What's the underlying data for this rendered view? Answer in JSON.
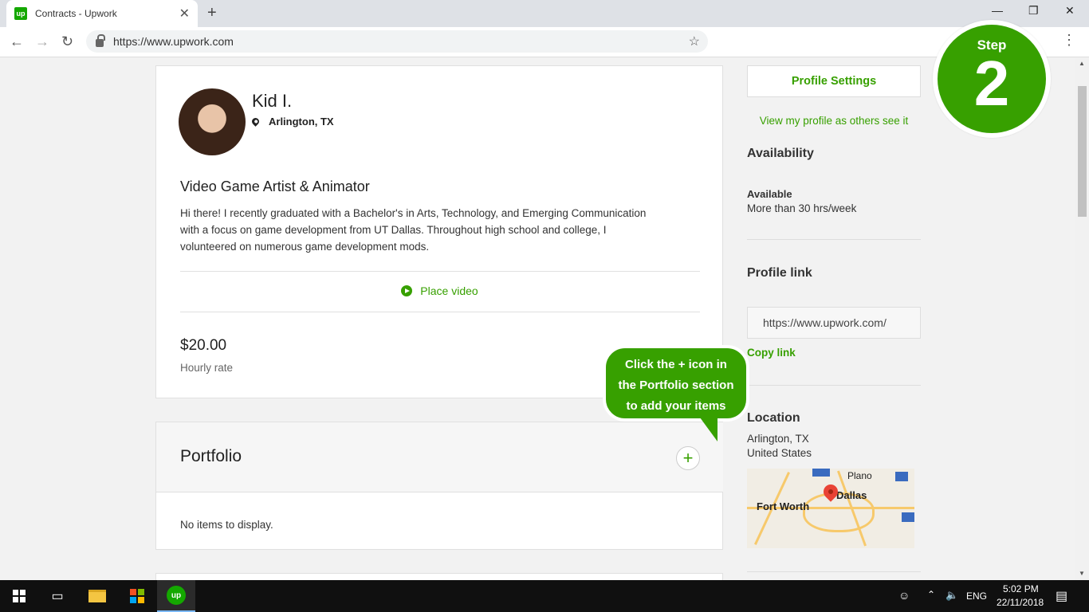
{
  "browser": {
    "tab_title": "Contracts - Upwork",
    "tab_favicon": "up",
    "url": "https://www.upwork.com"
  },
  "profile": {
    "name": "Kid I.",
    "location": "Arlington, TX",
    "headline": "Video Game Artist & Animator",
    "bio": "Hi there! I recently graduated with a Bachelor's in Arts, Technology, and Emerging Communication with a focus on game development from UT Dallas. Throughout high school and college, I volunteered on numerous game development mods.",
    "place_video_label": "Place video",
    "rate": "$20.00",
    "rate_label": "Hourly rate"
  },
  "portfolio": {
    "title": "Portfolio",
    "add_icon": "+",
    "empty_text": "No items to display."
  },
  "sidebar": {
    "settings_label": "Profile Settings",
    "view_profile_label": "View my profile as others see it",
    "availability_heading": "Availability",
    "availability_status": "Available",
    "availability_hours": "More than 30 hrs/week",
    "profile_link_heading": "Profile link",
    "profile_link_value": "https://www.upwork.com/",
    "copy_link_label": "Copy link",
    "location_heading": "Location",
    "location_city": "Arlington, TX",
    "location_country": "United States",
    "map_labels": {
      "plano": "Plano",
      "dallas": "Dallas",
      "fort_worth": "Fort Worth"
    }
  },
  "overlay": {
    "step_label": "Step",
    "step_number": "2",
    "callout_line1": "Click the + icon in",
    "callout_line2": "the Portfolio section",
    "callout_line3": "to add your items"
  },
  "taskbar": {
    "language": "ENG",
    "time": "5:02 PM",
    "date": "22/11/2018"
  },
  "colors": {
    "brand_green": "#37a000",
    "upwork_green": "#14a800"
  }
}
